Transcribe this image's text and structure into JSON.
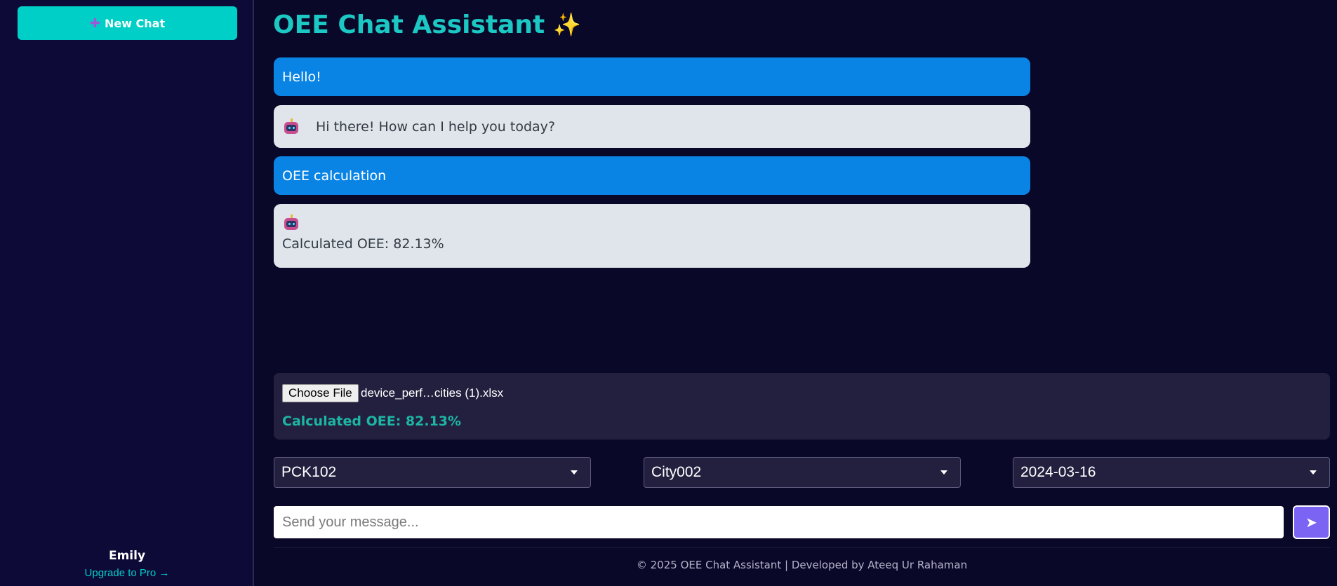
{
  "sidebar": {
    "new_chat_icon": "plus-icon",
    "new_chat_label": "New Chat",
    "user_name": "Emily",
    "upgrade_label": "Upgrade to Pro →"
  },
  "header": {
    "title": "OEE Chat Assistant",
    "title_icon": "✨"
  },
  "messages": [
    {
      "role": "user",
      "text": "Hello!"
    },
    {
      "role": "bot",
      "icon": "robot-icon",
      "text": "Hi there! How can I help you today?"
    },
    {
      "role": "user",
      "text": "OEE calculation"
    },
    {
      "role": "bot",
      "icon": "robot-icon",
      "text": "Calculated OEE: 82.13%"
    }
  ],
  "upload": {
    "button_label": "Choose File",
    "file_name": "device_perf…cities (1).xlsx",
    "result_text": "Calculated OEE: 82.13%"
  },
  "filters": {
    "device": "PCK102",
    "city": "City002",
    "date": "2024-03-16"
  },
  "composer": {
    "placeholder": "Send your message...",
    "send_icon": "➤"
  },
  "footer": {
    "text": "© 2025 OEE Chat Assistant | Developed by Ateeq Ur Rahaman"
  },
  "colors": {
    "accent": "#00cfc8",
    "user_bubble": "#0a84e4",
    "bot_bubble": "#dfe5ea",
    "send_button": "#7b63f3",
    "background": "#0a0828"
  }
}
